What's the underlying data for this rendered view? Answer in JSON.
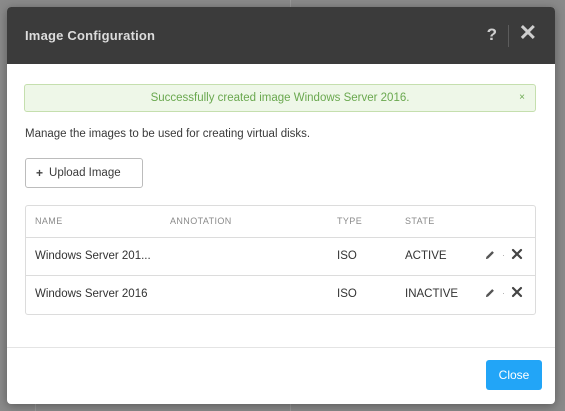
{
  "modal": {
    "title": "Image Configuration",
    "help_label": "?",
    "close_icon_glyph": "✕"
  },
  "alert": {
    "message": "Successfully created image Windows Server 2016.",
    "close_glyph": "×",
    "color": "#6aa84f"
  },
  "description": "Manage the images to be used for creating virtual disks.",
  "upload_button": {
    "icon": "plus-icon",
    "label": "Upload Image"
  },
  "table": {
    "headers": {
      "name": "NAME",
      "annotation": "ANNOTATION",
      "type": "TYPE",
      "state": "STATE"
    },
    "rows": [
      {
        "name": "Windows Server 201...",
        "annotation": "",
        "type": "ISO",
        "state": "ACTIVE"
      },
      {
        "name": "Windows Server 2016",
        "annotation": "",
        "type": "ISO",
        "state": "INACTIVE"
      }
    ]
  },
  "footer": {
    "close_label": "Close",
    "accent": "#22a5f7"
  }
}
